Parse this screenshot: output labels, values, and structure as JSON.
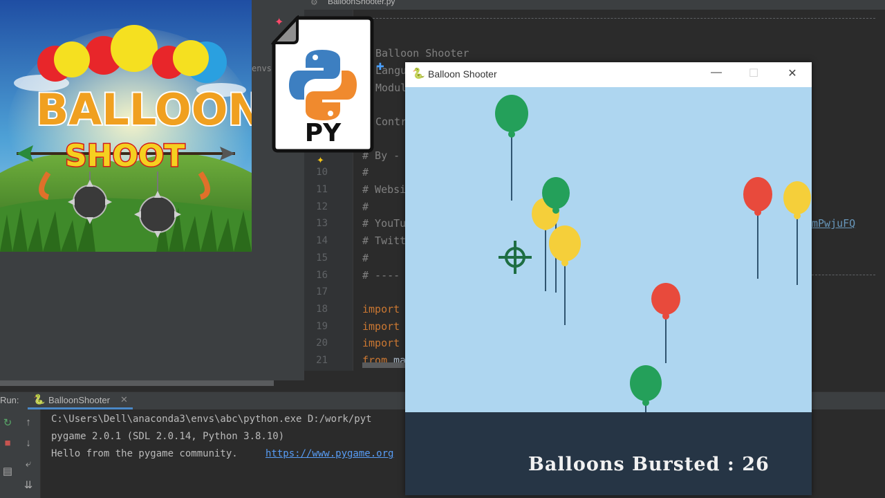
{
  "ide": {
    "file_tab": "BalloonShooter.py",
    "env_fragment": "envs\\a",
    "line_numbers": [
      "10",
      "11",
      "12",
      "13",
      "14",
      "15",
      "16",
      "17",
      "18",
      "19",
      "20",
      "21"
    ],
    "code": {
      "title_line": "Balloon Shooter",
      "lang_frag": "Langu",
      "module_frag": "Modul",
      "contr_frag": "Contr",
      "by_frag": "# By -",
      "l10": "#",
      "l11": "# Websi",
      "l12": "#",
      "l13": "# YouTu",
      "l13_link": "mPwjuFQ",
      "l14": "# Twitt",
      "l15": "#",
      "l16": "# ----",
      "l18_kw": "import",
      "l19_kw": "import",
      "l20_kw": "import",
      "l21_kw": "from",
      "l21_rest": " ma"
    }
  },
  "run": {
    "label": "Run:",
    "tab_label": "BalloonShooter",
    "lines": [
      "C:\\Users\\Dell\\anaconda3\\envs\\abc\\python.exe D:/work/pyt",
      "pygame 2.0.1 (SDL 2.0.14, Python 3.8.10)",
      "Hello from the pygame community. "
    ],
    "link": "https://www.pygame.org"
  },
  "game": {
    "window_title": "Balloon Shooter",
    "score_text": "Balloons Bursted : 26",
    "score_value": 26,
    "colors": {
      "green": "#24a05a",
      "yellow": "#f5cf3a",
      "red": "#e84a3c",
      "sky": "#aed6f0",
      "footer": "#263545"
    }
  },
  "thumbnail": {
    "title_word1": "BALLOON",
    "title_word2": "SHOOT"
  },
  "py_icon": {
    "label": "PY"
  }
}
